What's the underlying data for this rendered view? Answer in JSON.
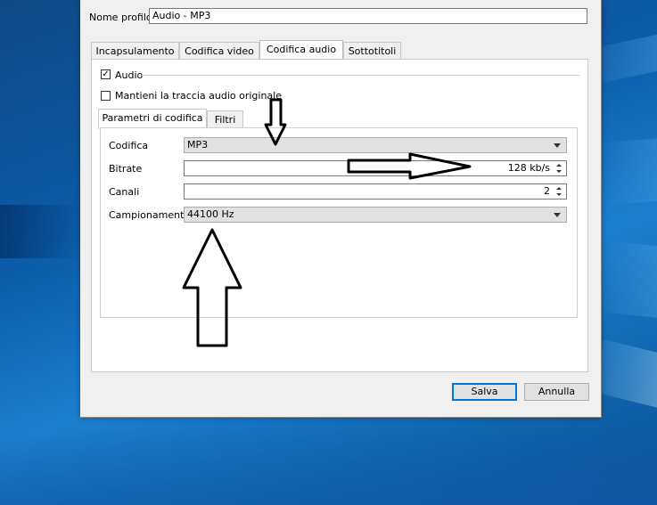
{
  "profile": {
    "label": "Nome profilo",
    "value": "Audio - MP3"
  },
  "tabs": [
    {
      "label": "Incapsulamento"
    },
    {
      "label": "Codifica video"
    },
    {
      "label": "Codifica audio"
    },
    {
      "label": "Sottotitoli"
    }
  ],
  "active_tab": "Codifica audio",
  "audio": {
    "checkbox_label": "Audio",
    "checked": true,
    "keep_original_label": "Mantieni la traccia audio originale",
    "keep_original_checked": false
  },
  "subtabs": [
    {
      "label": "Parametri di codifica"
    },
    {
      "label": "Filtri"
    }
  ],
  "fields": {
    "codec_label": "Codifica",
    "codec_value": "MP3",
    "bitrate_label": "Bitrate",
    "bitrate_value": "128 kb/s",
    "channels_label": "Canali",
    "channels_value": "2",
    "samplerate_label": "Campionamento",
    "samplerate_value": "44100 Hz"
  },
  "buttons": {
    "save": "Salva",
    "cancel": "Annulla"
  },
  "colors": {
    "accent": "#0078d7",
    "desktop": "#0b5aa6",
    "dialog": "#f0f0f0"
  },
  "icons": {
    "check": "✓"
  }
}
